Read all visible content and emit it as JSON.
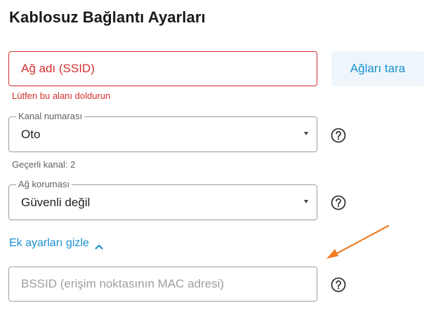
{
  "page": {
    "title": "Kablosuz Bağlantı Ayarları"
  },
  "ssid": {
    "placeholder": "Ağ adı (SSID)",
    "value": "",
    "error": "Lütfen bu alanı doldurun"
  },
  "scan_button": {
    "label": "Ağları tara"
  },
  "channel": {
    "label": "Kanal numarası",
    "value": "Oto",
    "helper": "Geçerli kanal: 2"
  },
  "security": {
    "label": "Ağ koruması",
    "value": "Güvenli değil"
  },
  "advanced_toggle": {
    "label": "Ek ayarları gizle",
    "icon": "chevron-up-icon"
  },
  "bssid": {
    "placeholder": "BSSID (erişim noktasının MAC adresi)",
    "value": ""
  },
  "icons": {
    "help": "help-circle-icon",
    "caret": "caret-down-icon"
  },
  "colors": {
    "accent": "#1a8fd1",
    "error": "#d32f2f",
    "scan_button_bg": "#eef6fb",
    "annotation_arrow": "#f07c22"
  }
}
